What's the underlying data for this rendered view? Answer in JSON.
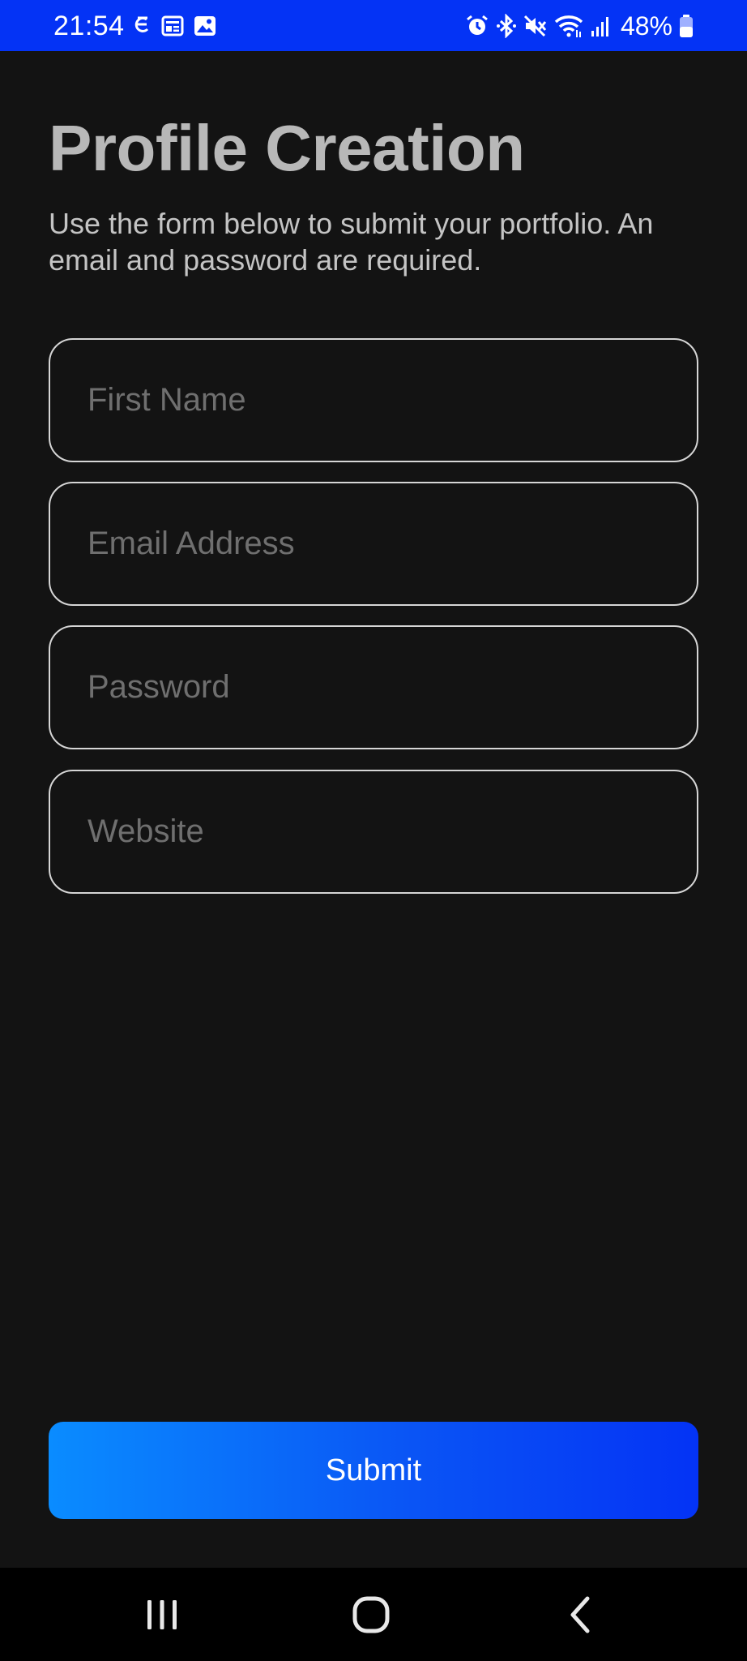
{
  "status_bar": {
    "time": "21:54",
    "battery": "48%",
    "left_icons": [
      "s-sync-icon",
      "news-icon",
      "gallery-icon"
    ],
    "right_icons": [
      "alarm-icon",
      "bluetooth-icon",
      "mute-icon",
      "wifi-icon",
      "signal-icon",
      "battery-icon"
    ],
    "background": "#0433f5"
  },
  "page": {
    "title": "Profile Creation",
    "subtitle": "Use the form below to submit your portfolio. An email and password are required."
  },
  "form": {
    "first_name": {
      "placeholder": "First Name",
      "value": ""
    },
    "email": {
      "placeholder": "Email Address",
      "value": ""
    },
    "password": {
      "placeholder": "Password",
      "value": ""
    },
    "website": {
      "placeholder": "Website",
      "value": ""
    },
    "submit_label": "Submit"
  },
  "nav_bar": {
    "buttons": [
      "recents-icon",
      "home-icon",
      "back-icon"
    ]
  },
  "colors": {
    "background": "#131313",
    "title": "#b8b8b8",
    "button_gradient_start": "#0a8cff",
    "button_gradient_end": "#0433f5"
  }
}
